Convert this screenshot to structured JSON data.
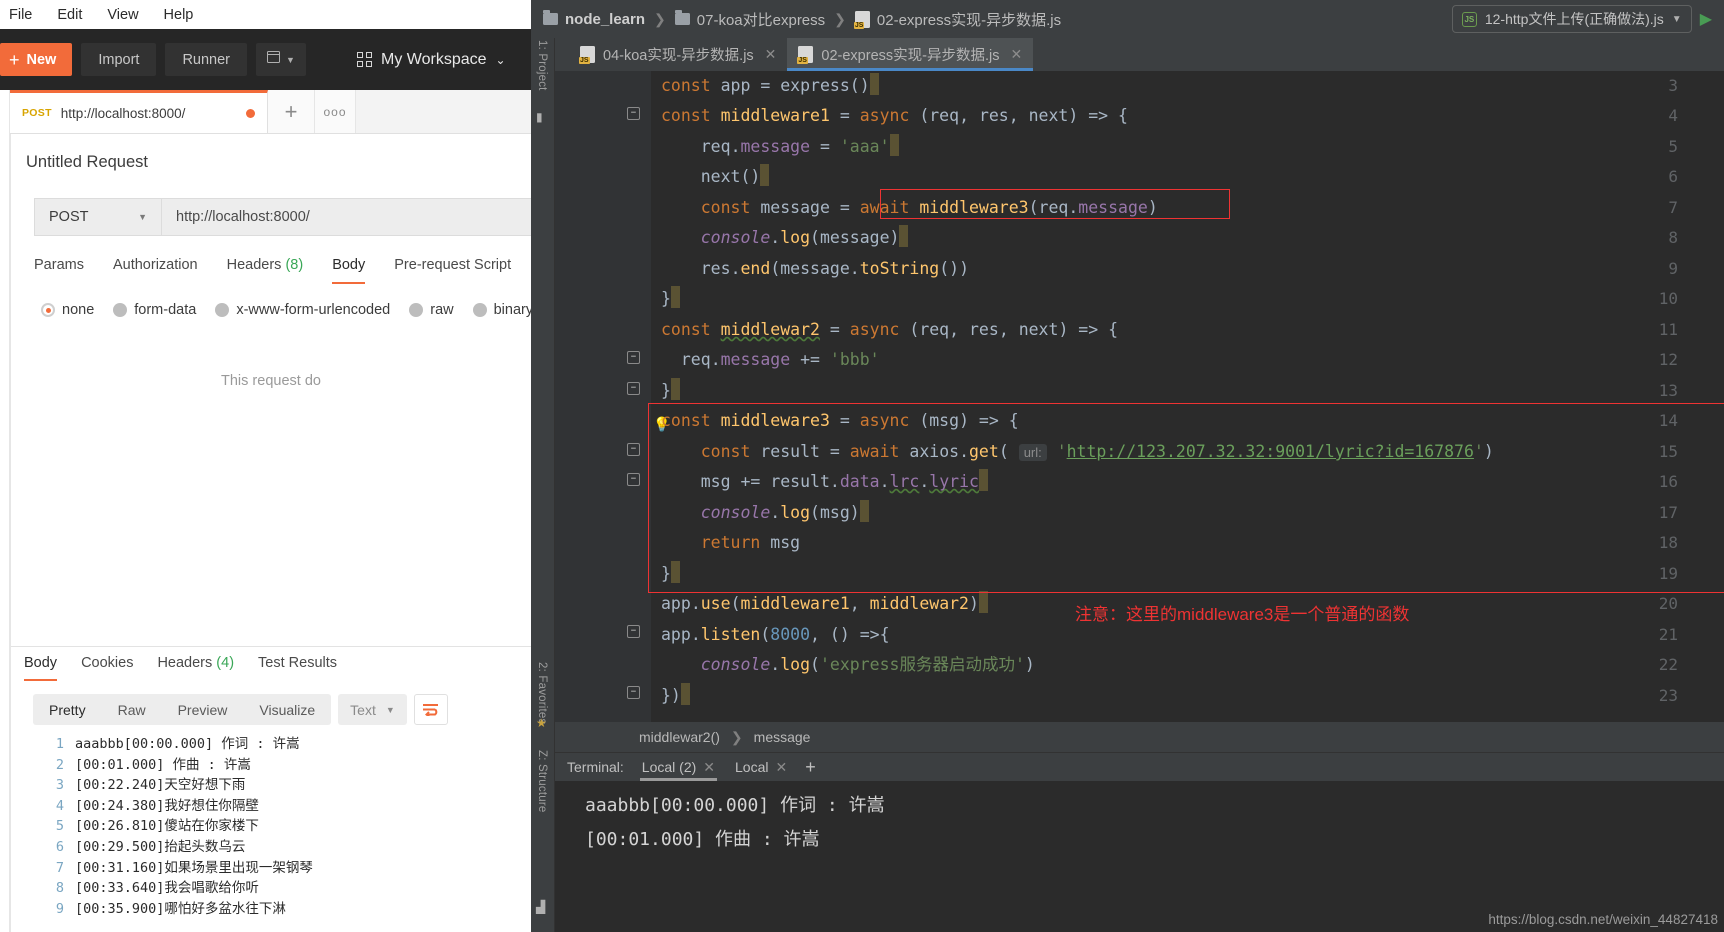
{
  "postman": {
    "menubar": [
      "File",
      "Edit",
      "View",
      "Help"
    ],
    "toolbar": {
      "new_label": "New",
      "new_plus": "+",
      "import_label": "Import",
      "runner_label": "Runner",
      "workspace_label": "My Workspace",
      "workspace_caret": "⌄"
    },
    "tab": {
      "method": "POST",
      "url": "http://localhost:8000/",
      "add_label": "+",
      "more_label": "ooo"
    },
    "request": {
      "title": "Untitled Request",
      "method": "POST",
      "method_caret": "▼",
      "url": "http://localhost:8000/",
      "tabs": [
        {
          "label": "Params",
          "count": "",
          "active": false
        },
        {
          "label": "Authorization",
          "count": "",
          "active": false
        },
        {
          "label": "Headers",
          "count": "(8)",
          "active": false
        },
        {
          "label": "Body",
          "count": "",
          "active": true
        },
        {
          "label": "Pre-request Script",
          "count": "",
          "active": false
        }
      ],
      "body_types": [
        {
          "label": "none",
          "selected": true
        },
        {
          "label": "form-data",
          "selected": false
        },
        {
          "label": "x-www-form-urlencoded",
          "selected": false
        },
        {
          "label": "raw",
          "selected": false
        },
        {
          "label": "binary",
          "selected": false
        }
      ],
      "empty_message": "This request do"
    },
    "response": {
      "tabs": [
        {
          "label": "Body",
          "count": "",
          "active": true
        },
        {
          "label": "Cookies",
          "count": "",
          "active": false
        },
        {
          "label": "Headers",
          "count": "(4)",
          "active": false
        },
        {
          "label": "Test Results",
          "count": "",
          "active": false
        }
      ],
      "views": [
        {
          "label": "Pretty",
          "active": true
        },
        {
          "label": "Raw",
          "active": false
        },
        {
          "label": "Preview",
          "active": false
        },
        {
          "label": "Visualize",
          "active": false
        }
      ],
      "format": "Text",
      "format_caret": "▼",
      "lines": [
        {
          "n": "1",
          "text": "aaabbb[00:00.000] 作词 : 许嵩"
        },
        {
          "n": "2",
          "text": "[00:01.000] 作曲 : 许嵩"
        },
        {
          "n": "3",
          "text": "[00:22.240]天空好想下雨"
        },
        {
          "n": "4",
          "text": "[00:24.380]我好想住你隔壁"
        },
        {
          "n": "5",
          "text": "[00:26.810]傻站在你家楼下"
        },
        {
          "n": "6",
          "text": "[00:29.500]抬起头数乌云"
        },
        {
          "n": "7",
          "text": "[00:31.160]如果场景里出现一架钢琴"
        },
        {
          "n": "8",
          "text": "[00:33.640]我会唱歌给你听"
        },
        {
          "n": "9",
          "text": "[00:35.900]哪怕好多盆水往下淋"
        }
      ]
    }
  },
  "ide": {
    "breadcrumb": [
      {
        "icon": "folder-icon",
        "label": "node_learn",
        "bold": true
      },
      {
        "icon": "folder-icon",
        "label": "07-koa对比express",
        "bold": false
      },
      {
        "icon": "js-file-icon",
        "label": "02-express实现-异步数据.js",
        "bold": false
      }
    ],
    "breadcrumb_separator": "❯",
    "run_config": {
      "label": "12-http文件上传(正确做法).js",
      "caret": "▼",
      "node_icon_text": "JS",
      "run_icon": "▶"
    },
    "editor_tabs": [
      {
        "label": "04-koa实现-异步数据.js",
        "active": false,
        "close": "✕"
      },
      {
        "label": "02-express实现-异步数据.js",
        "active": true,
        "close": "✕"
      }
    ],
    "rails": [
      {
        "label": "1: Project"
      },
      {
        "label": "2: Favorites"
      },
      {
        "label": "Z: Structure"
      }
    ],
    "code_lines": [
      {
        "n": "3",
        "fold": "",
        "text": "const app = express()"
      },
      {
        "n": "4",
        "fold": "−",
        "text": "const middleware1 = async (req, res, next) => {"
      },
      {
        "n": "5",
        "fold": "",
        "text": "    req.message = 'aaa'"
      },
      {
        "n": "6",
        "fold": "",
        "text": "    next()"
      },
      {
        "n": "7",
        "fold": "",
        "text": "    const message = await middleware3(req.message)"
      },
      {
        "n": "8",
        "fold": "",
        "text": "    console.log(message)"
      },
      {
        "n": "9",
        "fold": "",
        "text": "    res.end(message.toString())"
      },
      {
        "n": "10",
        "fold": "−",
        "text": "}"
      },
      {
        "n": "11",
        "fold": "−",
        "text": "const middlewar2 = async (req, res, next) => {"
      },
      {
        "n": "12",
        "fold": "",
        "text": "  req.message += 'bbb'"
      },
      {
        "n": "13",
        "fold": "−",
        "text": "}"
      },
      {
        "n": "14",
        "fold": "−",
        "text": "const middleware3 = async (msg) => {"
      },
      {
        "n": "15",
        "fold": "",
        "text": "    const result = await axios.get( url: 'http://123.207.32.32:9001/lyric?id=167876')"
      },
      {
        "n": "16",
        "fold": "",
        "text": "    msg += result.data.lrc.lyric"
      },
      {
        "n": "17",
        "fold": "",
        "text": "    console.log(msg)"
      },
      {
        "n": "18",
        "fold": "",
        "text": "    return msg"
      },
      {
        "n": "19",
        "fold": "−",
        "text": "}"
      },
      {
        "n": "20",
        "fold": "",
        "text": "app.use(middleware1, middlewar2)"
      },
      {
        "n": "21",
        "fold": "−",
        "text": "app.listen(8000, () =>{"
      },
      {
        "n": "22",
        "fold": "",
        "text": "    console.log('express服务器启动成功')"
      },
      {
        "n": "23",
        "fold": "−",
        "text": "})"
      }
    ],
    "param_hint": "url:",
    "axios_url": "http://123.207.32.32:9001/lyric?id=167876",
    "annotation": "注意：这里的middleware3是一个普通的函数",
    "bottom_breadcrumb": [
      "middlewar2()",
      "message"
    ],
    "bottom_breadcrumb_separator": "❯",
    "terminal": {
      "label": "Terminal:",
      "tabs": [
        {
          "label": "Local (2)",
          "active": true,
          "close": "✕"
        },
        {
          "label": "Local",
          "active": false,
          "close": "✕"
        }
      ],
      "add": "+",
      "output": "aaabbb[00:00.000] 作词 : 许嵩\n[00:01.000] 作曲 : 许嵩"
    },
    "watermark": "https://blog.csdn.net/weixin_44827418"
  },
  "colors": {
    "postman_accent": "#f26b3a",
    "ide_tab_accent": "#4a88c7",
    "annotation_red": "#ee3333",
    "editor_bg": "#2b2b2b"
  }
}
